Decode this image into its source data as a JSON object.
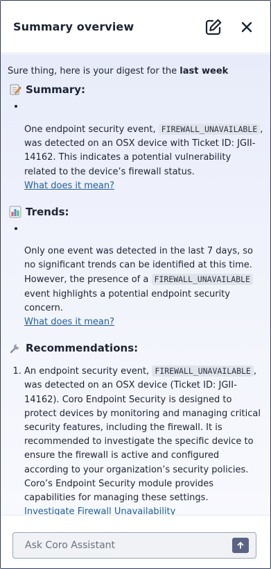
{
  "header": {
    "title": "Summary overview",
    "edit_icon": "edit-square-icon",
    "close_icon": "close-icon"
  },
  "intro": {
    "prefix": "Sure thing, here is your digest for the ",
    "emphasis": "last week"
  },
  "sections": {
    "summary": {
      "icon": "memo-icon",
      "title": "Summary:",
      "text_before": "One endpoint security event, ",
      "code": "FIREWALL_UNAVAILABLE",
      "text_after": ", was detected on an OSX device with Ticket ID: JGII-14162. This indicates a potential vulnerability related to the device’s firewall status.",
      "link": "What does it mean?"
    },
    "trends": {
      "icon": "bar-chart-icon",
      "title": "Trends:",
      "text_before": "Only one event was detected in the last 7 days, so no significant trends can be identified at this time. However, the presence of a ",
      "code": "FIREWALL_UNAVAILABLE",
      "text_after": " event highlights a potential endpoint security concern.",
      "link": "What does it mean?"
    },
    "recommendations": {
      "icon": "wrench-icon",
      "title": "Recommendations:",
      "text_before": "An endpoint security event, ",
      "code": "FIREWALL_UNAVAILABLE",
      "text_after": ", was detected on an OSX device (Ticket ID: JGII-14162). Coro Endpoint Security is designed to protect devices by monitoring and managing critical security features, including the firewall. It is recommended to investigate the specific device to ensure the firewall is active and configured according to your organization’s security policies. Coro’s Endpoint Security module provides capabilities for managing these settings.",
      "link": "Investigate Firewall Unavailability"
    }
  },
  "footer": {
    "placeholder": "Ask Coro Assistant",
    "value": "",
    "send_icon": "arrow-up-icon"
  },
  "colors": {
    "border": "#2e3a59",
    "link": "#1f5e9c",
    "send_button": "#5b6283"
  }
}
